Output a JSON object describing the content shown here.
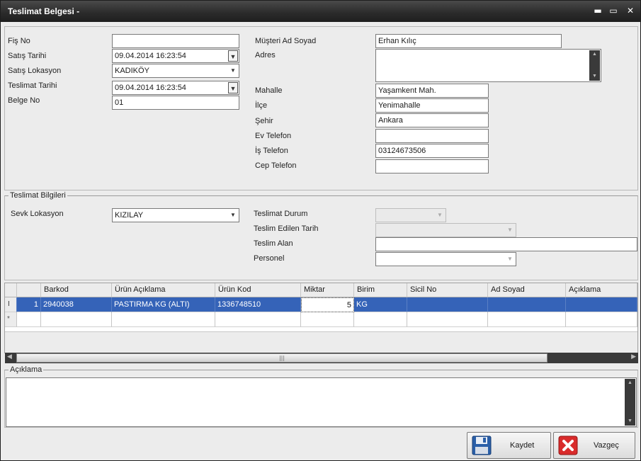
{
  "window": {
    "title": "Teslimat Belgesi -",
    "minimize": "▬",
    "maximize": "▭",
    "close": "✕"
  },
  "receipt": {
    "fis_no_label": "Fiş No",
    "fis_no_value": "",
    "satis_tarihi_label": "Satış Tarihi",
    "satis_tarihi_value": "09.04.2014 16:23:54",
    "satis_lokasyon_label": "Satış Lokasyon",
    "satis_lokasyon_value": "KADIKÖY",
    "teslimat_tarihi_label": "Teslimat Tarihi",
    "teslimat_tarihi_value": "09.04.2014 16:23:54",
    "belge_no_label": "Belge No",
    "belge_no_value": "01"
  },
  "customer": {
    "ad_soyad_label": "Müşteri Ad Soyad",
    "ad_soyad_value": "Erhan Kılıç",
    "adres_label": "Adres",
    "adres_value": "",
    "mahalle_label": "Mahalle",
    "mahalle_value": "Yaşamkent Mah.",
    "ilce_label": "İlçe",
    "ilce_value": "Yenimahalle",
    "sehir_label": "Şehir",
    "sehir_value": "Ankara",
    "ev_tel_label": "Ev Telefon",
    "ev_tel_value": "",
    "is_tel_label": "İş Telefon",
    "is_tel_value": "03124673506",
    "cep_tel_label": "Cep Telefon",
    "cep_tel_value": ""
  },
  "delivery": {
    "group_title": "Teslimat Bilgileri",
    "sevk_label": "Sevk Lokasyon",
    "sevk_value": "KIZILAY",
    "durum_label": "Teslimat Durum",
    "durum_value": "",
    "edilen_tarih_label": "Teslim Edilen Tarih",
    "edilen_tarih_value": "",
    "alan_label": "Teslim Alan",
    "alan_value": "",
    "personel_label": "Personel",
    "personel_value": ""
  },
  "grid": {
    "columns": [
      "Barkod",
      "Ürün Açıklama",
      "Ürün Kod",
      "Miktar",
      "Birim",
      "Sicil No",
      "Ad Soyad",
      "Açıklama"
    ],
    "row_marker": "I",
    "new_row_marker": "*",
    "rows": [
      {
        "no": "1",
        "barkod": "2940038",
        "urun_aciklama": "PASTIRMA KG (ALTI)",
        "urun_kod": "1336748510",
        "miktar": "5",
        "birim": "KG",
        "sicil_no": "",
        "ad_soyad": "",
        "aciklama": ""
      }
    ]
  },
  "notes": {
    "group_title": "Açıklama",
    "value": ""
  },
  "buttons": {
    "save": "Kaydet",
    "cancel": "Vazgeç"
  },
  "icons": {
    "save": "floppy-disk-icon",
    "cancel": "red-x-icon",
    "dropdown": "chevron-down-icon"
  },
  "colors": {
    "title_bar": "#2a2a2a",
    "selection": "#3563b8",
    "background": "#ececec"
  }
}
